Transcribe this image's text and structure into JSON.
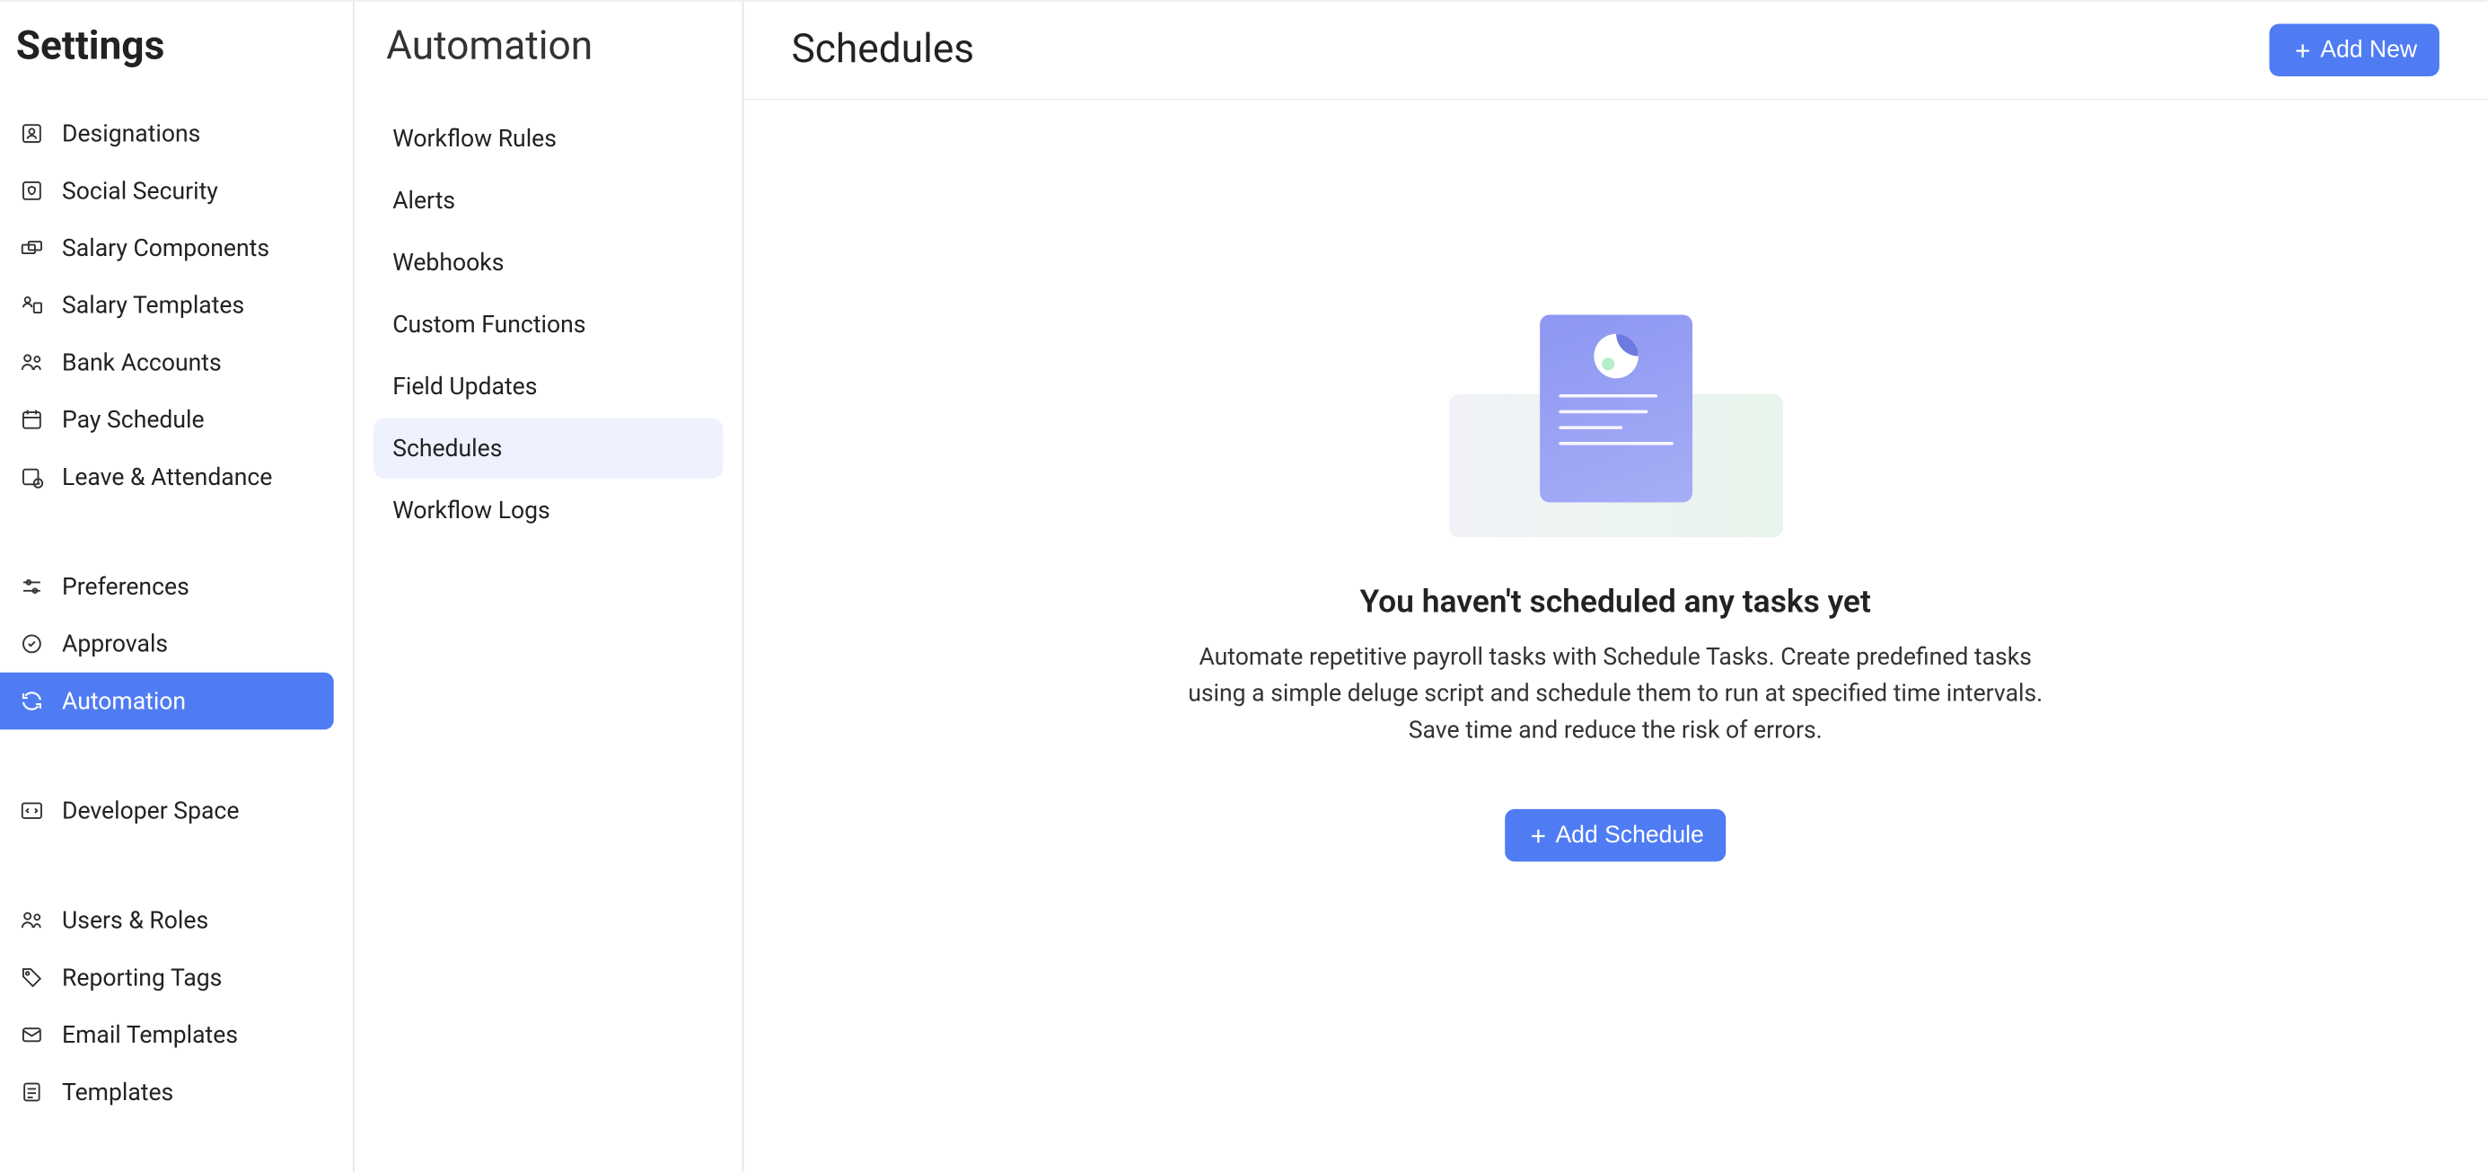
{
  "sidebar1": {
    "title": "Settings",
    "groups": [
      {
        "items": [
          {
            "label": "Designations",
            "icon": "id-card-icon"
          },
          {
            "label": "Social Security",
            "icon": "shield-card-icon"
          },
          {
            "label": "Salary Components",
            "icon": "money-stack-icon"
          },
          {
            "label": "Salary Templates",
            "icon": "user-doc-icon"
          },
          {
            "label": "Bank Accounts",
            "icon": "people-icon"
          },
          {
            "label": "Pay Schedule",
            "icon": "calendar-icon"
          },
          {
            "label": "Leave & Attendance",
            "icon": "calendar-clock-icon"
          }
        ]
      },
      {
        "items": [
          {
            "label": "Preferences",
            "icon": "sliders-icon"
          },
          {
            "label": "Approvals",
            "icon": "check-circle-icon"
          },
          {
            "label": "Automation",
            "icon": "refresh-icon",
            "active": true
          }
        ]
      },
      {
        "items": [
          {
            "label": "Developer Space",
            "icon": "code-icon"
          }
        ]
      },
      {
        "items": [
          {
            "label": "Users & Roles",
            "icon": "users-icon"
          },
          {
            "label": "Reporting Tags",
            "icon": "tag-icon"
          },
          {
            "label": "Email Templates",
            "icon": "mail-icon"
          },
          {
            "label": "Templates",
            "icon": "file-icon"
          }
        ]
      }
    ]
  },
  "sidebar2": {
    "title": "Automation",
    "items": [
      {
        "label": "Workflow Rules"
      },
      {
        "label": "Alerts"
      },
      {
        "label": "Webhooks"
      },
      {
        "label": "Custom Functions"
      },
      {
        "label": "Field Updates"
      },
      {
        "label": "Schedules",
        "active": true
      },
      {
        "label": "Workflow Logs"
      }
    ]
  },
  "main": {
    "title": "Schedules",
    "addNewLabel": "Add New",
    "empty": {
      "title": "You haven't scheduled any tasks yet",
      "description": "Automate repetitive payroll tasks with Schedule Tasks. Create predefined tasks using a simple deluge script and schedule them to run at specified time intervals. Save time and reduce the risk of errors.",
      "ctaLabel": "Add Schedule"
    }
  },
  "colors": {
    "primary": "#4f7cf3",
    "activeSubnavBg": "#eef2ff"
  }
}
